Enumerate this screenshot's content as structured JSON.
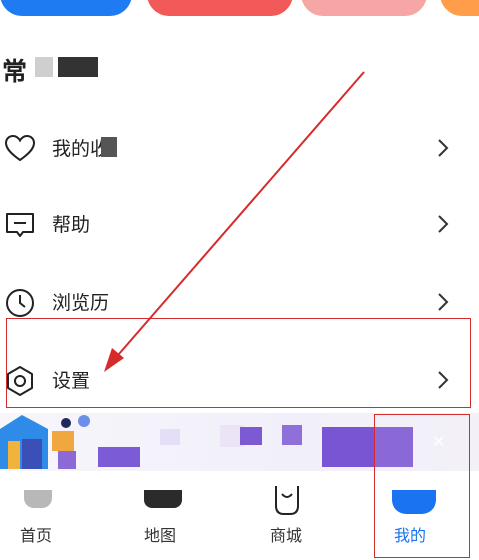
{
  "section": {
    "title": "常"
  },
  "menu": [
    {
      "label": "我的收"
    },
    {
      "label": "帮助"
    },
    {
      "label": "浏览历"
    },
    {
      "label": "设置"
    }
  ],
  "nav": [
    {
      "label": "首页"
    },
    {
      "label": "地图"
    },
    {
      "label": "商城"
    },
    {
      "label": "我的",
      "active": true
    }
  ],
  "colors": {
    "accent": "#1a73f0",
    "annotation": "#d62b2b"
  }
}
